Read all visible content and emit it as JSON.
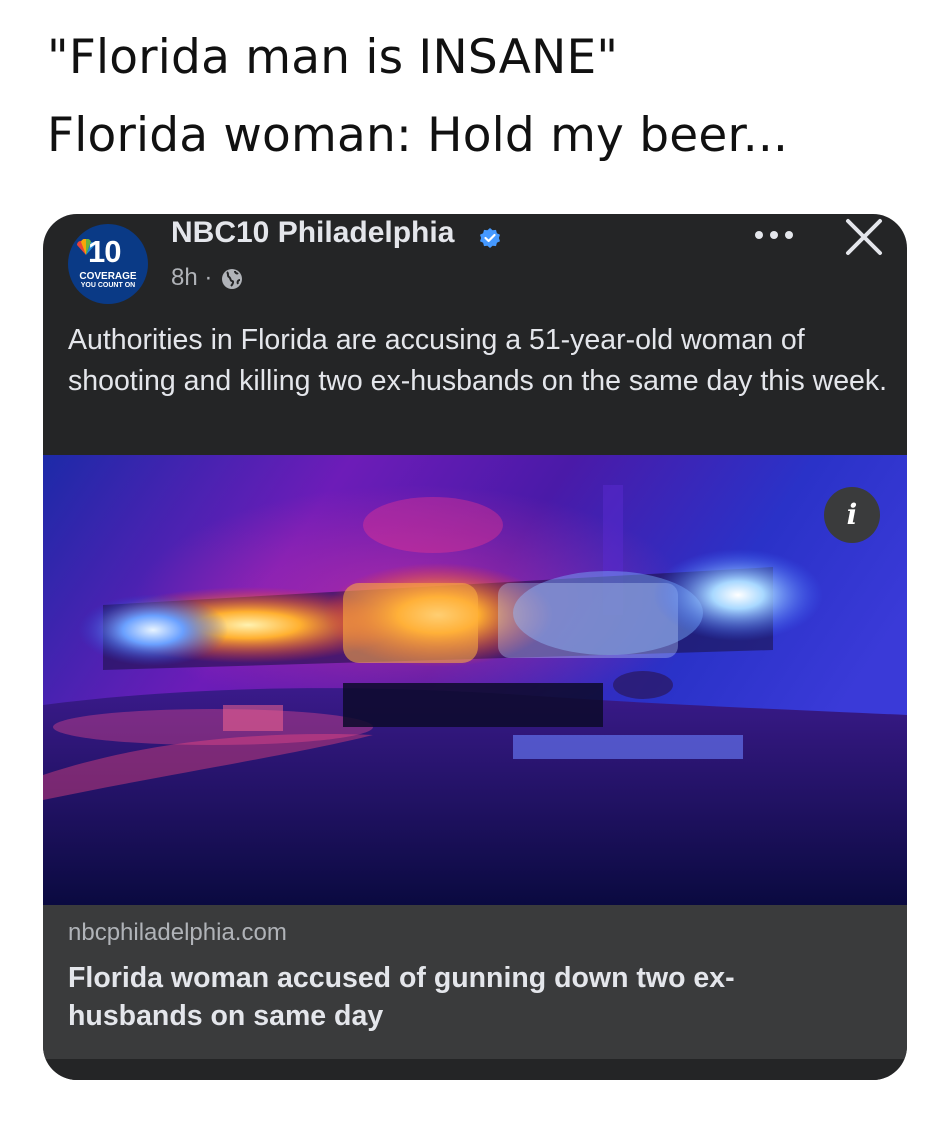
{
  "caption": {
    "line1": "\"Florida man is INSANE\"",
    "line2": "Florida woman: Hold my beer..."
  },
  "post": {
    "avatar": {
      "logo_number": "10",
      "logo_line1": "COVERAGE",
      "logo_line2": "YOU COUNT ON"
    },
    "page_name": "NBC10 Philadelphia",
    "verified_icon": "verified-badge-icon",
    "time": "8h",
    "separator": "·",
    "privacy_icon": "globe-icon",
    "more_icon": "more-options-icon",
    "close_icon": "close-icon",
    "text": "Authorities in Florida are accusing a 51-year-old woman of shooting and killing two ex-husbands on the same day this week.",
    "image_info_icon": "info-icon",
    "image_info_glyph": "i",
    "link": {
      "domain": "nbcphiladelphia.com",
      "headline": "Florida woman accused of gunning down two ex-husbands on same day"
    }
  },
  "colors": {
    "card_background": "#242526",
    "link_background": "#3a3b3c",
    "primary_text": "#e4e6eb",
    "secondary_text": "#b0b3b8",
    "verified_blue": "#4599ff",
    "logo_blue": "#0a3a86"
  }
}
